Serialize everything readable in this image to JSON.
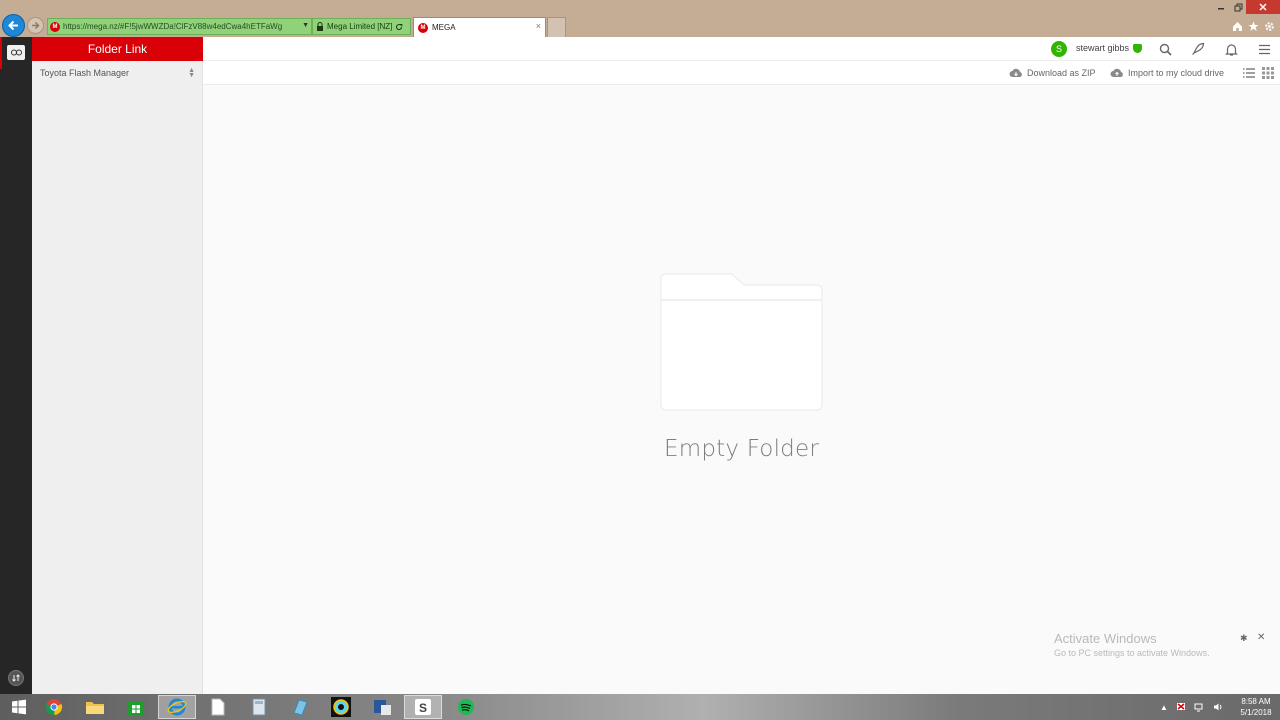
{
  "browser": {
    "url": "https://mega.nz/#F!5jwWWZDa!ClFzV88w4edCwa4hETFaWg",
    "site_identity": "Mega Limited [NZ]",
    "tab_title": "MEGA",
    "tab_close": "×"
  },
  "sidebar": {
    "header": "Folder Link",
    "folder_name": "Toyota Flash Manager"
  },
  "header": {
    "user_initial": "S",
    "user_name": "stewart gibbs"
  },
  "toolbar": {
    "download_label": "Download as ZIP",
    "import_label": "Import to my cloud drive"
  },
  "content": {
    "empty_label": "Empty Folder"
  },
  "watermark": {
    "title": "Activate Windows",
    "subtitle": "Go to PC settings to activate Windows."
  },
  "taskbar": {
    "clock_time": "8:58 AM",
    "clock_date": "5/1/2018"
  },
  "colors": {
    "brand_red": "#d90007",
    "online_green": "#31b500",
    "address_green": "#8fd27a",
    "rail_dark": "#262626"
  },
  "icons": {
    "browser": [
      "back-arrow-icon",
      "forward-arrow-icon",
      "lock-icon",
      "refresh-icon",
      "home-icon",
      "star-icon",
      "gear-icon"
    ],
    "header": [
      "search-icon",
      "rocket-icon",
      "bell-icon",
      "menu-icon"
    ],
    "toolbar": [
      "cloud-download-icon",
      "cloud-upload-icon",
      "list-view-icon",
      "grid-view-icon"
    ],
    "taskbar": [
      "windows-start-icon",
      "chrome-icon",
      "file-explorer-icon",
      "store-icon",
      "internet-explorer-icon",
      "document-icon",
      "calculator-icon",
      "app-icon",
      "paint-icon",
      "office-icon",
      "slack-icon",
      "spotify-icon"
    ]
  }
}
